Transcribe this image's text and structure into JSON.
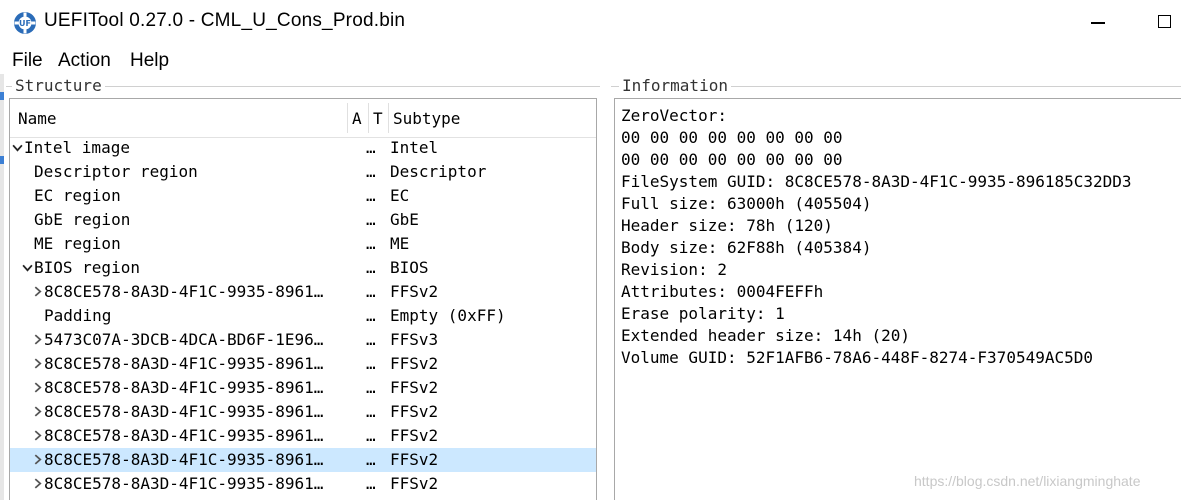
{
  "window": {
    "title": "UEFITool 0.27.0 - CML_U_Cons_Prod.bin",
    "icon": "uefitool-gear-icon",
    "controls": [
      "minimize-icon",
      "maximize-icon"
    ]
  },
  "menu": {
    "items": [
      "File",
      "Action",
      "Help"
    ]
  },
  "structure": {
    "label": "Structure",
    "columns": {
      "name": "Name",
      "action": "A",
      "type": "T",
      "subtype": "Subtype"
    },
    "rows": [
      {
        "name": "Intel image",
        "dots": "…",
        "subtype": "Intel",
        "expander": "expanded",
        "level": 0,
        "selected": false
      },
      {
        "name": "Descriptor region",
        "dots": "…",
        "subtype": "Descriptor",
        "expander": "none",
        "level": 1,
        "selected": false
      },
      {
        "name": "EC region",
        "dots": "…",
        "subtype": "EC",
        "expander": "none",
        "level": 1,
        "selected": false
      },
      {
        "name": "GbE region",
        "dots": "…",
        "subtype": "GbE",
        "expander": "none",
        "level": 1,
        "selected": false
      },
      {
        "name": "ME region",
        "dots": "…",
        "subtype": "ME",
        "expander": "none",
        "level": 1,
        "selected": false
      },
      {
        "name": "BIOS region",
        "dots": "…",
        "subtype": "BIOS",
        "expander": "expanded",
        "level": 1,
        "selected": false
      },
      {
        "name": "8C8CE578-8A3D-4F1C-9935-8961…",
        "dots": "…",
        "subtype": "FFSv2",
        "expander": "collapsed",
        "level": 2,
        "selected": false
      },
      {
        "name": "Padding",
        "dots": "…",
        "subtype": "Empty (0xFF)",
        "expander": "none",
        "level": 2,
        "selected": false
      },
      {
        "name": "5473C07A-3DCB-4DCA-BD6F-1E96…",
        "dots": "…",
        "subtype": "FFSv3",
        "expander": "collapsed",
        "level": 2,
        "selected": false
      },
      {
        "name": "8C8CE578-8A3D-4F1C-9935-8961…",
        "dots": "…",
        "subtype": "FFSv2",
        "expander": "collapsed",
        "level": 2,
        "selected": false
      },
      {
        "name": "8C8CE578-8A3D-4F1C-9935-8961…",
        "dots": "…",
        "subtype": "FFSv2",
        "expander": "collapsed",
        "level": 2,
        "selected": false
      },
      {
        "name": "8C8CE578-8A3D-4F1C-9935-8961…",
        "dots": "…",
        "subtype": "FFSv2",
        "expander": "collapsed",
        "level": 2,
        "selected": false
      },
      {
        "name": "8C8CE578-8A3D-4F1C-9935-8961…",
        "dots": "…",
        "subtype": "FFSv2",
        "expander": "collapsed",
        "level": 2,
        "selected": false
      },
      {
        "name": "8C8CE578-8A3D-4F1C-9935-8961…",
        "dots": "…",
        "subtype": "FFSv2",
        "expander": "collapsed",
        "level": 2,
        "selected": true
      },
      {
        "name": "8C8CE578-8A3D-4F1C-9935-8961…",
        "dots": "…",
        "subtype": "FFSv2",
        "expander": "collapsed",
        "level": 2,
        "selected": false
      }
    ]
  },
  "information": {
    "label": "Information",
    "lines": [
      "ZeroVector:",
      "00 00 00 00 00 00 00 00",
      "00 00 00 00 00 00 00 00",
      "FileSystem GUID: 8C8CE578-8A3D-4F1C-9935-896185C32DD3",
      "Full size: 63000h (405504)",
      "Header size: 78h (120)",
      "Body size: 62F88h (405384)",
      "Revision: 2",
      "Attributes: 0004FEFFh",
      "Erase polarity: 1",
      "Extended header size: 14h (20)",
      "Volume GUID: 52F1AFB6-78A6-448F-8274-F370549AC5D0"
    ]
  },
  "watermark": "https://blog.csdn.net/lixiangminghate",
  "colors": {
    "selection": "#cce8ff",
    "accent": "#3c7fd4"
  }
}
